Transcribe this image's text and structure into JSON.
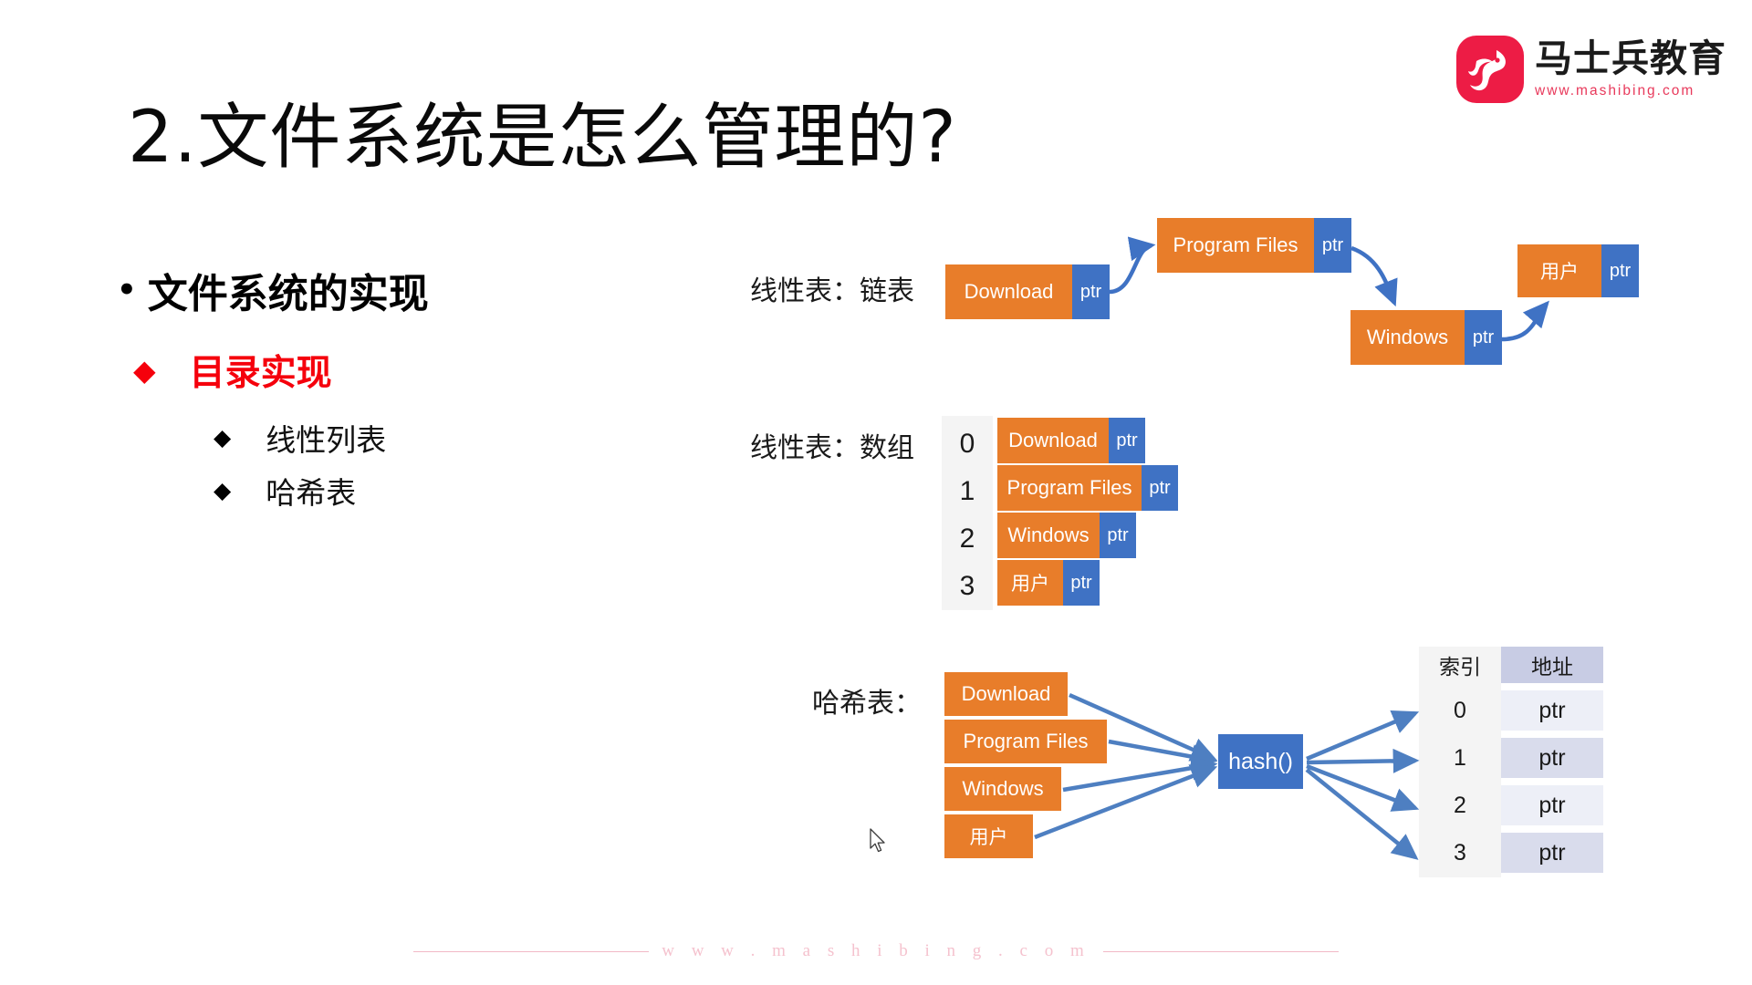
{
  "brand": {
    "logo_cn": "马士兵教育",
    "logo_url": "www.mashibing.com",
    "footer_text": "w w w . m a s h i b i n g . c o m"
  },
  "slide": {
    "title": "2.文件系统是怎么管理的?"
  },
  "outline": {
    "level1": "文件系统的实现",
    "level2": "目录实现",
    "level3": [
      "线性列表",
      "哈希表"
    ]
  },
  "linked_list": {
    "label": "线性表：链表",
    "nodes": [
      {
        "name": "Download",
        "ptr": "ptr"
      },
      {
        "name": "Program Files",
        "ptr": "ptr"
      },
      {
        "name": "Windows",
        "ptr": "ptr"
      },
      {
        "name": "用户",
        "ptr": "ptr"
      }
    ]
  },
  "array_list": {
    "label": "线性表：数组",
    "rows": [
      {
        "index": "0",
        "name": "Download",
        "ptr": "ptr"
      },
      {
        "index": "1",
        "name": "Program Files",
        "ptr": "ptr"
      },
      {
        "index": "2",
        "name": "Windows",
        "ptr": "ptr"
      },
      {
        "index": "3",
        "name": "用户",
        "ptr": "ptr"
      }
    ]
  },
  "hash_table": {
    "label": "哈希表：",
    "keys": [
      "Download",
      "Program Files",
      "Windows",
      "用户"
    ],
    "function": "hash()",
    "table": {
      "headers": [
        "索引",
        "地址"
      ],
      "rows": [
        {
          "index": "0",
          "address": "ptr"
        },
        {
          "index": "1",
          "address": "ptr"
        },
        {
          "index": "2",
          "address": "ptr"
        },
        {
          "index": "3",
          "address": "ptr"
        }
      ]
    }
  },
  "colors": {
    "orange": "#E87D2A",
    "blue": "#3F72C4",
    "arrow_blue": "#4E7FC1",
    "red": "#F5000C",
    "brand_red": "#ED1C45",
    "table_header": "#C8CCE4",
    "table_row_alt": "#D9DCEC",
    "table_row": "#EDEFF7",
    "index_col": "#F4F4F4"
  }
}
